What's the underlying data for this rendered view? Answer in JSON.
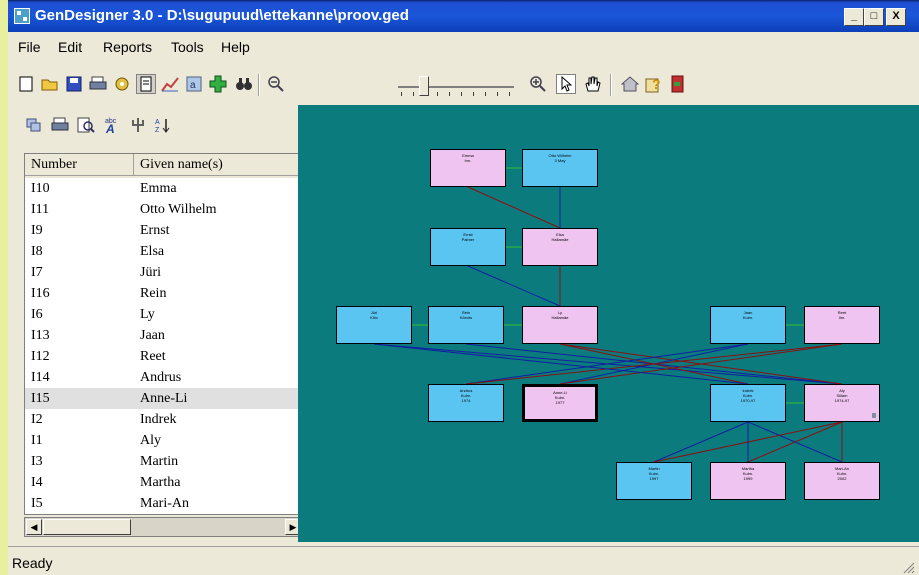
{
  "window": {
    "title": "GenDesigner 3.0 - D:\\sugupuud\\ettekanne\\proov.ged",
    "controls": [
      "_",
      "□",
      "X"
    ]
  },
  "menu": [
    "File",
    "Edit",
    "Reports",
    "Tools",
    "Help"
  ],
  "toolbar": {
    "icons": [
      "new-icon",
      "open-icon",
      "save-icon",
      "print-icon",
      "settings-icon",
      "page-icon",
      "chart-icon",
      "text-icon",
      "add-icon",
      "binoculars-icon",
      "zoom-out-icon",
      "zoom-in-icon",
      "pointer-icon",
      "hand-icon",
      "home-icon",
      "help-icon",
      "exit-icon"
    ],
    "zoom_level": 0.2
  },
  "list": {
    "headers": [
      "Number",
      "Given name(s)"
    ],
    "rows": [
      {
        "number": "I10",
        "name": "Emma"
      },
      {
        "number": "I11",
        "name": "Otto Wilhelm"
      },
      {
        "number": "I9",
        "name": "Ernst"
      },
      {
        "number": "I8",
        "name": "Elsa"
      },
      {
        "number": "I7",
        "name": "Jüri"
      },
      {
        "number": "I16",
        "name": "Rein"
      },
      {
        "number": "I6",
        "name": "Ly"
      },
      {
        "number": "I13",
        "name": "Jaan"
      },
      {
        "number": "I12",
        "name": "Reet"
      },
      {
        "number": "I14",
        "name": "Andrus"
      },
      {
        "number": "I15",
        "name": "Anne-Li"
      },
      {
        "number": "I2",
        "name": "Indrek"
      },
      {
        "number": "I1",
        "name": "Aly"
      },
      {
        "number": "I3",
        "name": "Martin"
      },
      {
        "number": "I4",
        "name": "Martha"
      },
      {
        "number": "I5",
        "name": "Mari-An"
      }
    ],
    "selected_index": 10
  },
  "tree": {
    "nodes": [
      {
        "id": "n1",
        "line1": "Emma",
        "line2": "Irm.",
        "line3": ""
      },
      {
        "id": "n2",
        "line1": "Otto Wilhelm",
        "line2": "3 May",
        "line3": ""
      },
      {
        "id": "n3",
        "line1": "Ernst",
        "line2": "Palmer",
        "line3": ""
      },
      {
        "id": "n4",
        "line1": "Elsa",
        "line2": "Hallamäe",
        "line3": ""
      },
      {
        "id": "n5",
        "line1": "Jüri",
        "line2": "Kõiv",
        "line3": ""
      },
      {
        "id": "n6",
        "line1": "Rein",
        "line2": "Kõrvits",
        "line3": ""
      },
      {
        "id": "n7",
        "line1": "Ly",
        "line2": "Hallamäe",
        "line3": ""
      },
      {
        "id": "n8",
        "line1": "Jaan",
        "line2": "Kulm.",
        "line3": ""
      },
      {
        "id": "n9",
        "line1": "Reet",
        "line2": "Ilm.",
        "line3": ""
      },
      {
        "id": "n10",
        "line1": "Andrus",
        "line2": "Kulm.",
        "line3": "1974"
      },
      {
        "id": "n11",
        "line1": "Anne-Li",
        "line2": "Kulm.",
        "line3": "1977"
      },
      {
        "id": "n12",
        "line1": "Indrek",
        "line2": "Kulm.",
        "line3": "1970-97"
      },
      {
        "id": "n13",
        "line1": "Aly",
        "line2": "Sillam",
        "line3": "1974-97"
      },
      {
        "id": "n14",
        "line1": "Martin",
        "line2": "Kulm.",
        "line3": "1997"
      },
      {
        "id": "n15",
        "line1": "Martha",
        "line2": "Kulm.",
        "line3": "1999"
      },
      {
        "id": "n16",
        "line1": "Mari-An",
        "line2": "Kulm.",
        "line3": "2002"
      }
    ]
  },
  "status": {
    "text": "Ready"
  }
}
